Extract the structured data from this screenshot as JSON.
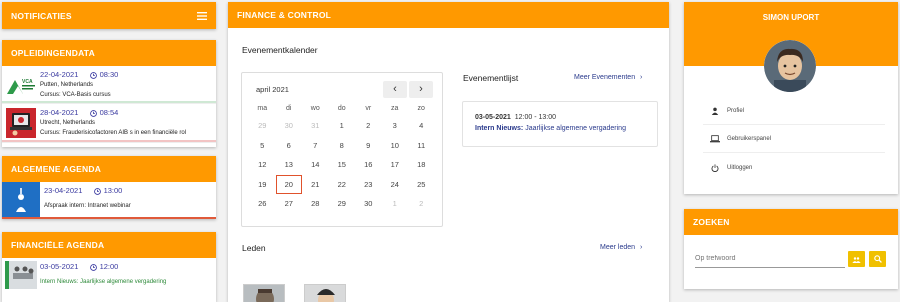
{
  "notifications": {
    "title": "NOTIFICATIES"
  },
  "opleidingen": {
    "title": "OPLEIDINGENDATA",
    "items": [
      {
        "date": "22-04-2021",
        "time": "08:30",
        "place": "Putten, Netherlands",
        "course": "Cursus: VCA-Basis cursus",
        "logo_text": "VCA"
      },
      {
        "date": "28-04-2021",
        "time": "08:54",
        "place": "Utrecht, Netherlands",
        "course": "Cursus: Frauderisicofactoren AIB s in een financiële rol"
      }
    ]
  },
  "algemene": {
    "title": "ALGEMENE AGENDA",
    "items": [
      {
        "date": "23-04-2021",
        "time": "13:00",
        "text": "Afspraak intern: Intranet webinar"
      }
    ]
  },
  "financiele": {
    "title": "FINANCIËLE AGENDA",
    "items": [
      {
        "date": "03-05-2021",
        "time": "12:00",
        "text": "Intern Nieuws: Jaarlijkse algemene vergadering"
      }
    ]
  },
  "finance": {
    "title": "FINANCE & CONTROL",
    "calendar_title": "Evenementkalender",
    "month": "april 2021",
    "weekdays": [
      "ma",
      "di",
      "wo",
      "do",
      "vr",
      "za",
      "zo"
    ],
    "weeks": [
      [
        "29",
        "30",
        "31",
        "1",
        "2",
        "3",
        "4"
      ],
      [
        "5",
        "6",
        "7",
        "8",
        "9",
        "10",
        "11"
      ],
      [
        "12",
        "13",
        "14",
        "15",
        "16",
        "17",
        "18"
      ],
      [
        "19",
        "20",
        "21",
        "22",
        "23",
        "24",
        "25"
      ],
      [
        "26",
        "27",
        "28",
        "29",
        "30",
        "1",
        "2"
      ]
    ],
    "events_title": "Evenementlijst",
    "more_events": "Meer Evenementen",
    "event": {
      "date": "03-05-2021",
      "time": "12:00 - 13:00",
      "category": "Intern Nieuws:",
      "text": "Jaarlijkse algemene vergadering"
    },
    "members_title": "Leden",
    "more_members": "Meer leden"
  },
  "profile": {
    "name": "SIMON UPORT",
    "menu": [
      "Profiel",
      "Gebruikerspanel",
      "Uitloggen"
    ]
  },
  "search": {
    "title": "ZOEKEN",
    "placeholder": "Op trefwoord"
  },
  "colors": {
    "accent": "#ff9900",
    "link": "#2a3a8c",
    "today_border": "#e0522c"
  }
}
